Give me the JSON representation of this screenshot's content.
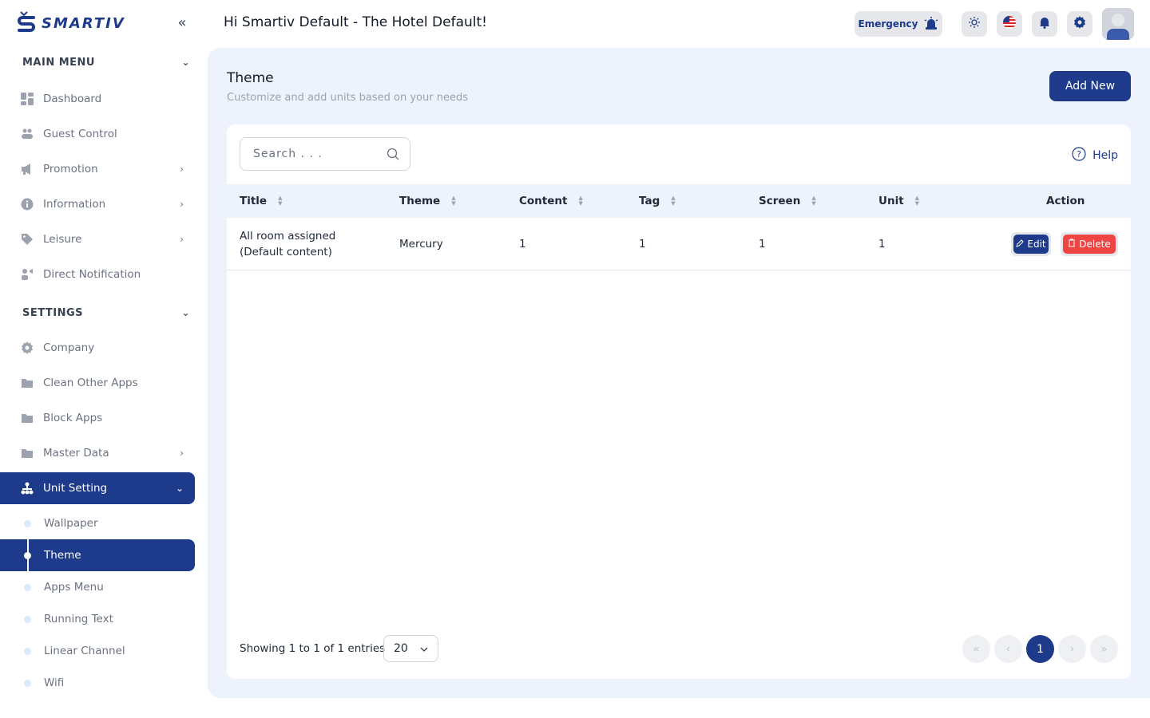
{
  "brand": {
    "name": "SMARTIV"
  },
  "sidebar": {
    "main_menu": {
      "label": "MAIN MENU",
      "items": [
        {
          "label": "Dashboard",
          "icon": "dashboard-icon"
        },
        {
          "label": "Guest Control",
          "icon": "users-icon"
        },
        {
          "label": "Promotion",
          "icon": "megaphone-icon"
        },
        {
          "label": "Information",
          "icon": "info-icon"
        },
        {
          "label": "Leisure",
          "icon": "tag-icon"
        },
        {
          "label": "Direct Notification",
          "icon": "notification-icon"
        }
      ]
    },
    "settings": {
      "label": "SETTINGS",
      "items": [
        {
          "label": "Company",
          "icon": "gear-icon"
        },
        {
          "label": "Clean Other Apps",
          "icon": "folder-icon"
        },
        {
          "label": "Block Apps",
          "icon": "folder-icon"
        },
        {
          "label": "Master Data",
          "icon": "folder-icon"
        },
        {
          "label": "Unit Setting",
          "icon": "hierarchy-icon"
        }
      ],
      "unit_setting_sub": [
        {
          "label": "Wallpaper"
        },
        {
          "label": "Theme"
        },
        {
          "label": "Apps Menu"
        },
        {
          "label": "Running Text"
        },
        {
          "label": "Linear Channel"
        },
        {
          "label": "Wifi"
        }
      ]
    }
  },
  "header": {
    "greeting": "Hi Smartiv Default - The Hotel Default!",
    "emergency_label": "Emergency"
  },
  "page": {
    "title": "Theme",
    "subtitle": "Customize and add units based on your needs",
    "add_label": "Add New"
  },
  "table": {
    "search_placeholder": "Search . . .",
    "help_label": "Help",
    "columns": [
      "Title",
      "Theme",
      "Content",
      "Tag",
      "Screen",
      "Unit",
      "Action"
    ],
    "rows": [
      {
        "title_line1": "All room assigned",
        "title_line2": "(Default content)",
        "theme": "Mercury",
        "content": "1",
        "tag": "1",
        "screen": "1",
        "unit": "1"
      }
    ],
    "edit_label": "Edit",
    "delete_label": "Delete",
    "showing": "Showing 1 to 1 of 1 entries",
    "per_page": "20",
    "current_page": "1"
  },
  "colors": {
    "primary": "#1e3a8a",
    "danger": "#ef4444",
    "panel": "#eef2fc"
  }
}
